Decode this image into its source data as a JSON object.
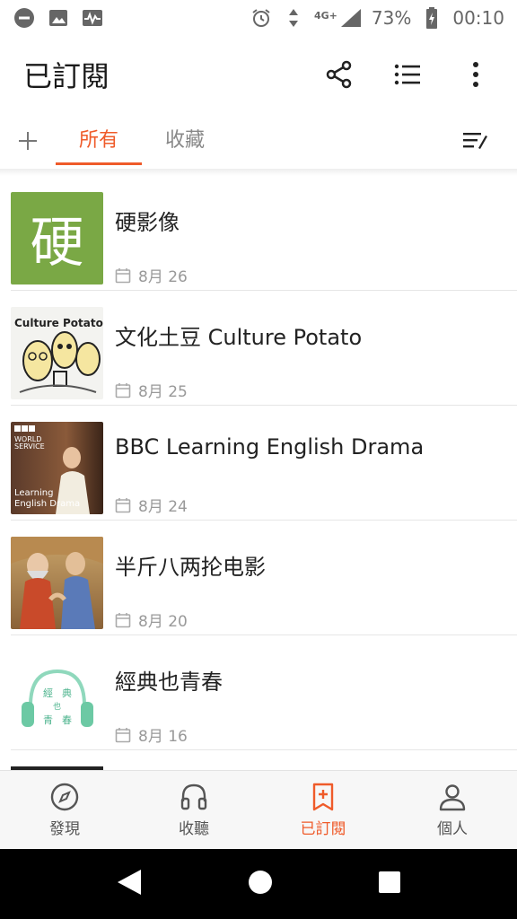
{
  "status_bar": {
    "left_icons": [
      "minus-circle-icon",
      "image-icon",
      "activity-icon"
    ],
    "network": "4G+",
    "battery": "73%",
    "time": "00:10"
  },
  "app_bar": {
    "title": "已訂閱",
    "actions": [
      "share-icon",
      "list-icon",
      "more-vertical-icon"
    ]
  },
  "tabs": {
    "items": [
      {
        "label": "所有",
        "active": true
      },
      {
        "label": "收藏",
        "active": false
      }
    ]
  },
  "subscriptions": [
    {
      "title": "硬影像",
      "date": "8月 26",
      "thumb_text": "硬",
      "thumb_color": "#7aa845"
    },
    {
      "title": "文化土豆 Culture Potato",
      "date": "8月 25",
      "thumb_text": "Culture Potato"
    },
    {
      "title": "BBC Learning English Drama",
      "date": "8月 24",
      "thumb_text": "BBC WORLD SERVICE Learning English Drama"
    },
    {
      "title": "半斤八两抡电影",
      "date": "8月 20"
    },
    {
      "title": "經典也青春",
      "date": "8月 16",
      "thumb_text": "經典也青春",
      "thumb_color": "#6cc9a4"
    }
  ],
  "bottom_nav": [
    {
      "label": "發現",
      "icon": "compass-icon",
      "active": false
    },
    {
      "label": "收聽",
      "icon": "headphones-icon",
      "active": false
    },
    {
      "label": "已訂閱",
      "icon": "bookmark-add-icon",
      "active": true
    },
    {
      "label": "個人",
      "icon": "person-icon",
      "active": false
    }
  ],
  "colors": {
    "accent": "#ef5b2a"
  }
}
